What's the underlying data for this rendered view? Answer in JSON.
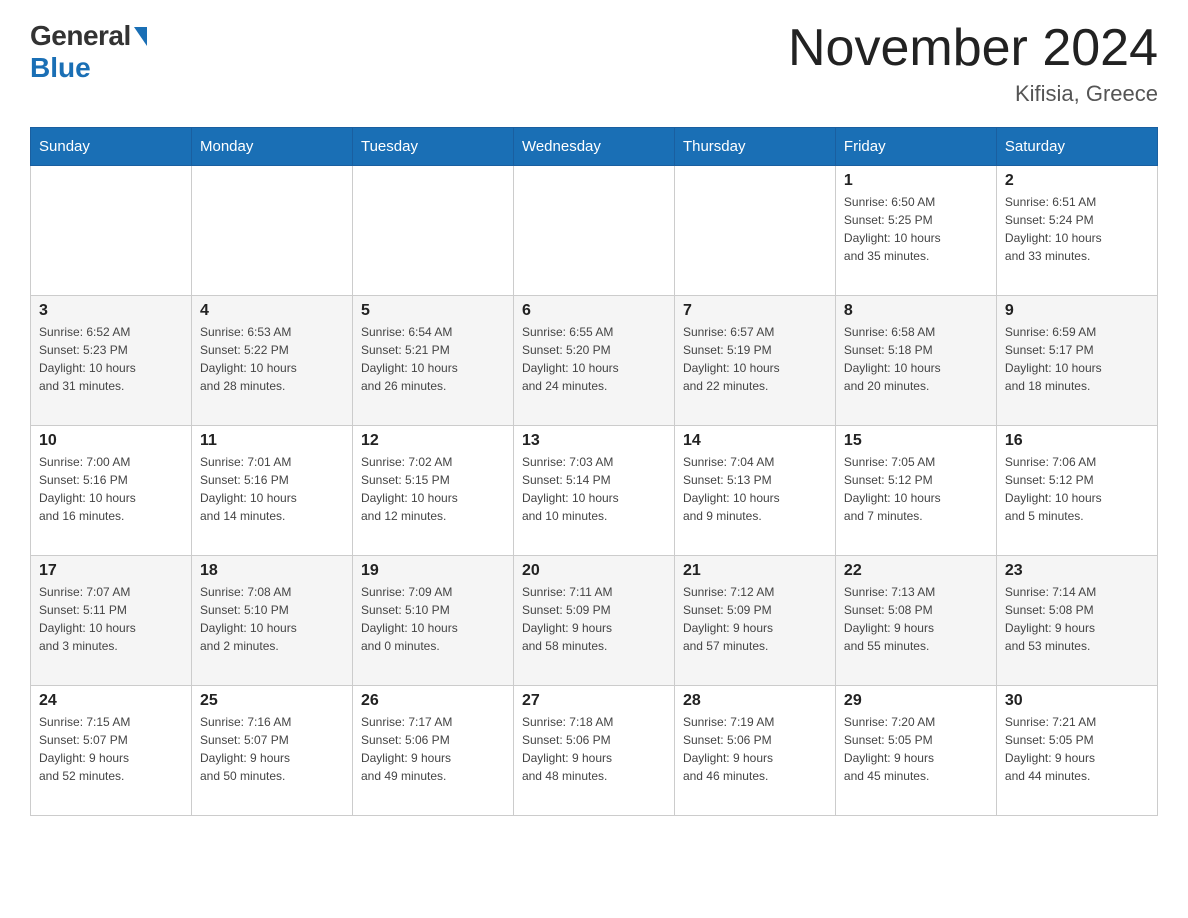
{
  "header": {
    "logo_general": "General",
    "logo_blue": "Blue",
    "month_title": "November 2024",
    "location": "Kifisia, Greece"
  },
  "days_of_week": [
    "Sunday",
    "Monday",
    "Tuesday",
    "Wednesday",
    "Thursday",
    "Friday",
    "Saturday"
  ],
  "weeks": [
    [
      {
        "day": "",
        "info": ""
      },
      {
        "day": "",
        "info": ""
      },
      {
        "day": "",
        "info": ""
      },
      {
        "day": "",
        "info": ""
      },
      {
        "day": "",
        "info": ""
      },
      {
        "day": "1",
        "info": "Sunrise: 6:50 AM\nSunset: 5:25 PM\nDaylight: 10 hours\nand 35 minutes."
      },
      {
        "day": "2",
        "info": "Sunrise: 6:51 AM\nSunset: 5:24 PM\nDaylight: 10 hours\nand 33 minutes."
      }
    ],
    [
      {
        "day": "3",
        "info": "Sunrise: 6:52 AM\nSunset: 5:23 PM\nDaylight: 10 hours\nand 31 minutes."
      },
      {
        "day": "4",
        "info": "Sunrise: 6:53 AM\nSunset: 5:22 PM\nDaylight: 10 hours\nand 28 minutes."
      },
      {
        "day": "5",
        "info": "Sunrise: 6:54 AM\nSunset: 5:21 PM\nDaylight: 10 hours\nand 26 minutes."
      },
      {
        "day": "6",
        "info": "Sunrise: 6:55 AM\nSunset: 5:20 PM\nDaylight: 10 hours\nand 24 minutes."
      },
      {
        "day": "7",
        "info": "Sunrise: 6:57 AM\nSunset: 5:19 PM\nDaylight: 10 hours\nand 22 minutes."
      },
      {
        "day": "8",
        "info": "Sunrise: 6:58 AM\nSunset: 5:18 PM\nDaylight: 10 hours\nand 20 minutes."
      },
      {
        "day": "9",
        "info": "Sunrise: 6:59 AM\nSunset: 5:17 PM\nDaylight: 10 hours\nand 18 minutes."
      }
    ],
    [
      {
        "day": "10",
        "info": "Sunrise: 7:00 AM\nSunset: 5:16 PM\nDaylight: 10 hours\nand 16 minutes."
      },
      {
        "day": "11",
        "info": "Sunrise: 7:01 AM\nSunset: 5:16 PM\nDaylight: 10 hours\nand 14 minutes."
      },
      {
        "day": "12",
        "info": "Sunrise: 7:02 AM\nSunset: 5:15 PM\nDaylight: 10 hours\nand 12 minutes."
      },
      {
        "day": "13",
        "info": "Sunrise: 7:03 AM\nSunset: 5:14 PM\nDaylight: 10 hours\nand 10 minutes."
      },
      {
        "day": "14",
        "info": "Sunrise: 7:04 AM\nSunset: 5:13 PM\nDaylight: 10 hours\nand 9 minutes."
      },
      {
        "day": "15",
        "info": "Sunrise: 7:05 AM\nSunset: 5:12 PM\nDaylight: 10 hours\nand 7 minutes."
      },
      {
        "day": "16",
        "info": "Sunrise: 7:06 AM\nSunset: 5:12 PM\nDaylight: 10 hours\nand 5 minutes."
      }
    ],
    [
      {
        "day": "17",
        "info": "Sunrise: 7:07 AM\nSunset: 5:11 PM\nDaylight: 10 hours\nand 3 minutes."
      },
      {
        "day": "18",
        "info": "Sunrise: 7:08 AM\nSunset: 5:10 PM\nDaylight: 10 hours\nand 2 minutes."
      },
      {
        "day": "19",
        "info": "Sunrise: 7:09 AM\nSunset: 5:10 PM\nDaylight: 10 hours\nand 0 minutes."
      },
      {
        "day": "20",
        "info": "Sunrise: 7:11 AM\nSunset: 5:09 PM\nDaylight: 9 hours\nand 58 minutes."
      },
      {
        "day": "21",
        "info": "Sunrise: 7:12 AM\nSunset: 5:09 PM\nDaylight: 9 hours\nand 57 minutes."
      },
      {
        "day": "22",
        "info": "Sunrise: 7:13 AM\nSunset: 5:08 PM\nDaylight: 9 hours\nand 55 minutes."
      },
      {
        "day": "23",
        "info": "Sunrise: 7:14 AM\nSunset: 5:08 PM\nDaylight: 9 hours\nand 53 minutes."
      }
    ],
    [
      {
        "day": "24",
        "info": "Sunrise: 7:15 AM\nSunset: 5:07 PM\nDaylight: 9 hours\nand 52 minutes."
      },
      {
        "day": "25",
        "info": "Sunrise: 7:16 AM\nSunset: 5:07 PM\nDaylight: 9 hours\nand 50 minutes."
      },
      {
        "day": "26",
        "info": "Sunrise: 7:17 AM\nSunset: 5:06 PM\nDaylight: 9 hours\nand 49 minutes."
      },
      {
        "day": "27",
        "info": "Sunrise: 7:18 AM\nSunset: 5:06 PM\nDaylight: 9 hours\nand 48 minutes."
      },
      {
        "day": "28",
        "info": "Sunrise: 7:19 AM\nSunset: 5:06 PM\nDaylight: 9 hours\nand 46 minutes."
      },
      {
        "day": "29",
        "info": "Sunrise: 7:20 AM\nSunset: 5:05 PM\nDaylight: 9 hours\nand 45 minutes."
      },
      {
        "day": "30",
        "info": "Sunrise: 7:21 AM\nSunset: 5:05 PM\nDaylight: 9 hours\nand 44 minutes."
      }
    ]
  ]
}
